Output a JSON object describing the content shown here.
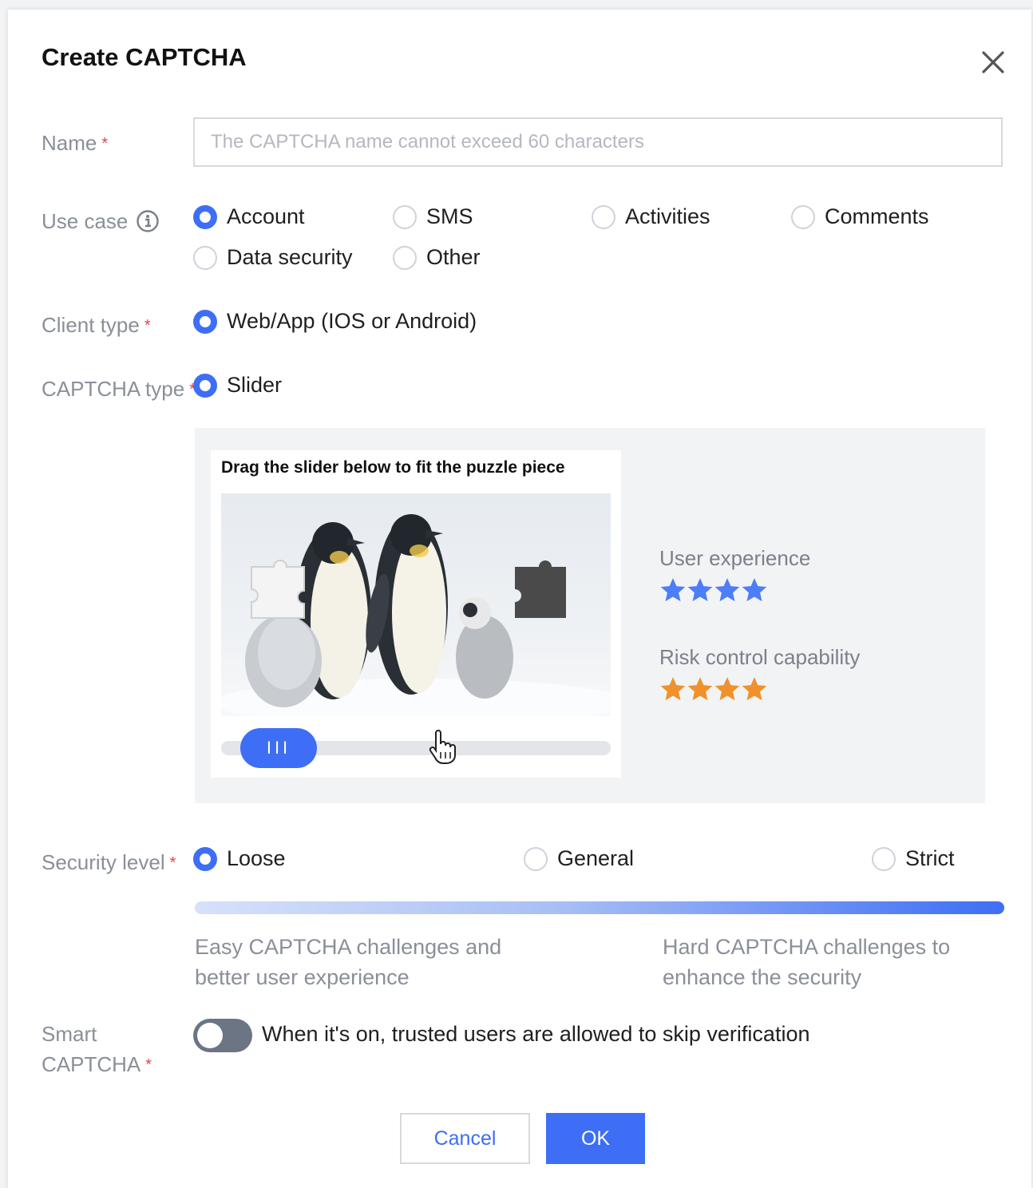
{
  "dialog": {
    "title": "Create CAPTCHA"
  },
  "form": {
    "name": {
      "label": "Name",
      "required_mark": "*",
      "placeholder": "The CAPTCHA name cannot exceed 60 characters"
    },
    "use_case": {
      "label": "Use case",
      "options": [
        "Account",
        "SMS",
        "Activities",
        "Comments",
        "Data security",
        "Other"
      ],
      "selected": "Account"
    },
    "client_type": {
      "label": "Client type",
      "required_mark": "*",
      "options": [
        "Web/App (IOS or Android)"
      ],
      "selected": "Web/App (IOS or Android)"
    },
    "captcha_type": {
      "label": "CAPTCHA type",
      "required_mark": "*",
      "options": [
        "Slider"
      ],
      "selected": "Slider"
    },
    "preview": {
      "instruction": "Drag the slider below to fit the puzzle piece",
      "handle_glyph": "III",
      "user_experience": {
        "label": "User experience",
        "stars": 4,
        "color": "#4d7ef7"
      },
      "risk_control": {
        "label": "Risk control capability",
        "stars": 4,
        "color": "#f0912a"
      }
    },
    "security_level": {
      "label": "Security level",
      "required_mark": "*",
      "options": [
        "Loose",
        "General",
        "Strict"
      ],
      "selected": "Loose",
      "easy_desc": "Easy CAPTCHA challenges and better user experience",
      "hard_desc": "Hard CAPTCHA challenges to enhance the security"
    },
    "smart_captcha": {
      "label_line1": "Smart",
      "label_line2": "CAPTCHA",
      "required_mark": "*",
      "enabled": false,
      "description": "When it's on, trusted users are allowed to skip verification"
    }
  },
  "buttons": {
    "cancel": "Cancel",
    "ok": "OK"
  },
  "colors": {
    "accent": "#3d6ef5",
    "required": "#e54545"
  }
}
